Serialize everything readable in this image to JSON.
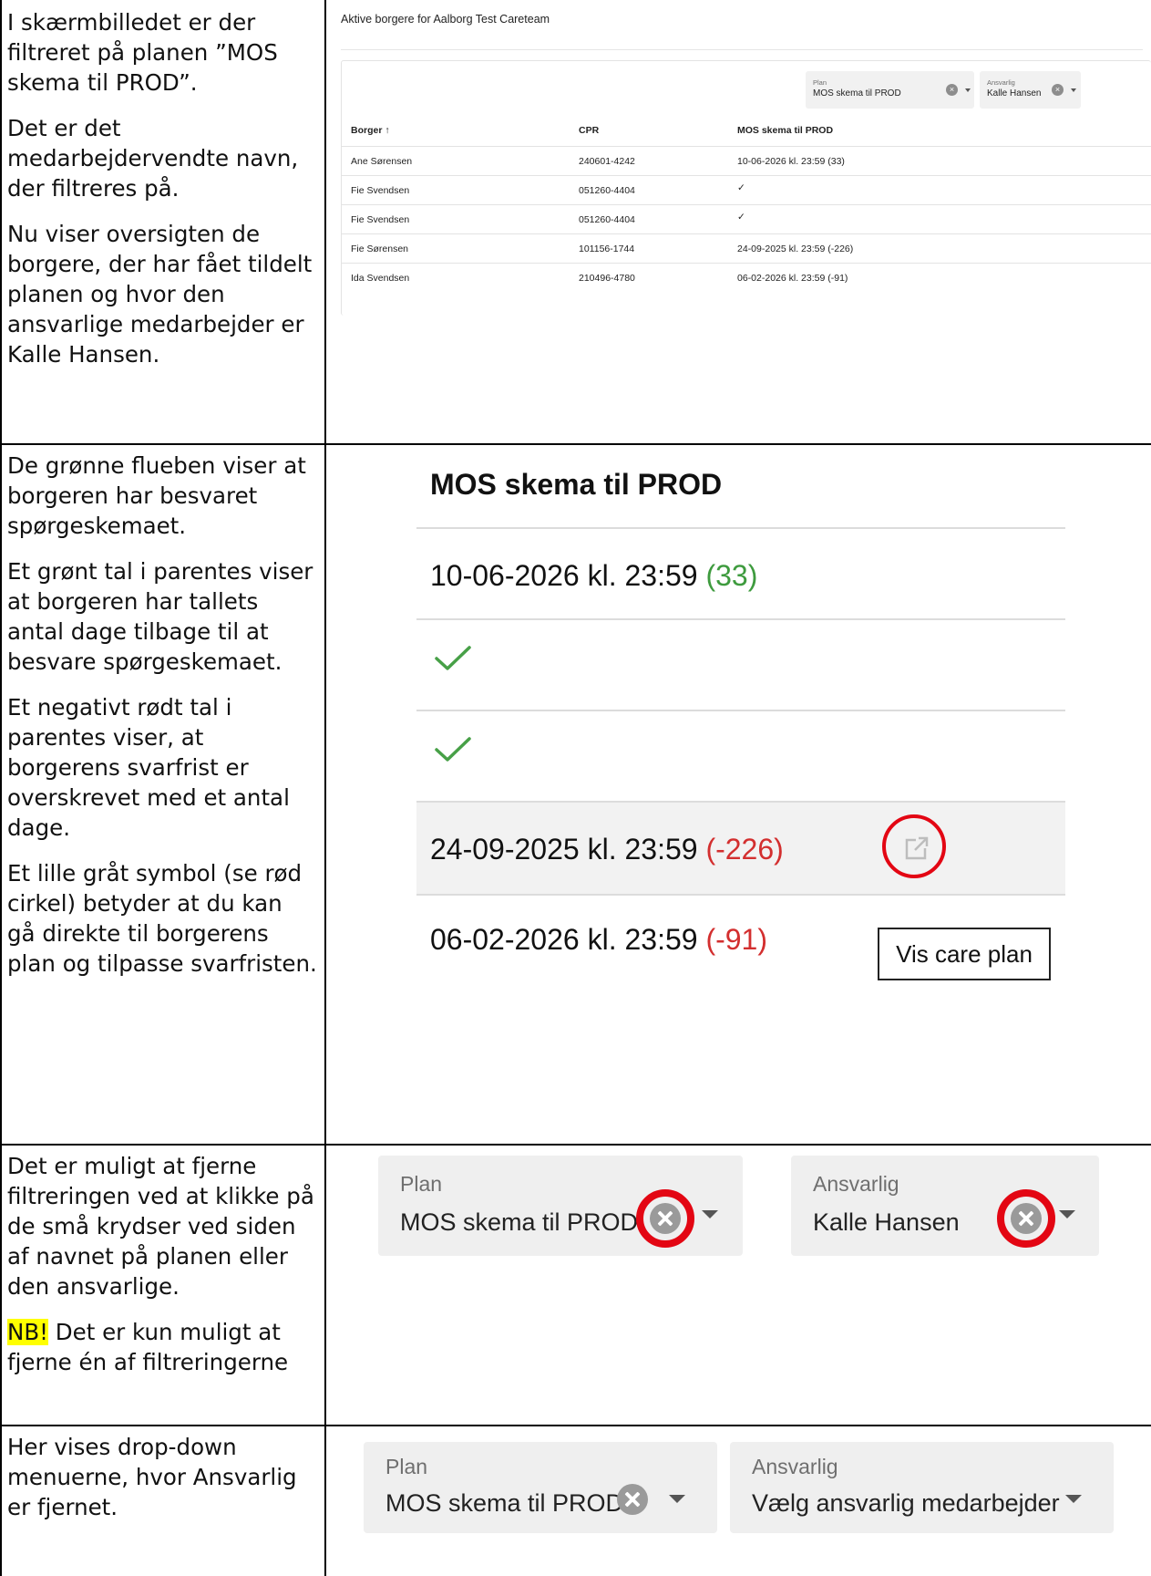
{
  "left_column": {
    "section1": [
      "I skærmbilledet er der filtreret på planen ”MOS skema til PROD”.",
      "Det er det medarbejdervendte navn, der filtreres på.",
      "Nu viser oversigten de borgere, der har fået tildelt planen og hvor den ansvarlige medarbejder er Kalle Hansen."
    ],
    "section2": [
      "De grønne flueben viser at borgeren har besvaret spørgeskemaet.",
      "Et grønt tal i parentes viser at borgeren har tallets antal dage tilbage til at besvare spørgeskemaet.",
      "Et negativt rødt tal i parentes viser, at borgerens svarfrist er overskrevet med et antal dage.",
      "Et lille gråt symbol (se rød cirkel) betyder at du kan gå direkte til borgerens plan og tilpasse svarfristen."
    ],
    "section3": {
      "p1": "Det er muligt at fjerne filtreringen ved at klikke på de små krydser ved siden af navnet på planen eller den ansvarlige.",
      "nb_label": "NB!",
      "nb_text": " Det er kun muligt at fjerne én af filtreringerne"
    },
    "section4": [
      "Her vises drop-down menuerne, hvor Ansvarlig er fjernet."
    ]
  },
  "overview": {
    "heading": "Aktive borgere for Aalborg Test Careteam",
    "plan_filter": {
      "label": "Plan",
      "value": "MOS skema til PROD"
    },
    "responsible_filter": {
      "label": "Ansvarlig",
      "value": "Kalle Hansen"
    },
    "columns": {
      "borger": "Borger ↑",
      "cpr": "CPR",
      "plan": "MOS skema til PROD"
    },
    "rows": [
      {
        "name": "Ane Sørensen",
        "cpr": "240601-4242",
        "date": "10-06-2026 kl. 23:59 ",
        "days": "(33)",
        "status": "green"
      },
      {
        "name": "Fie Svendsen",
        "cpr": "051260-4404",
        "date": "",
        "days": "",
        "status": "check"
      },
      {
        "name": "Fie Svendsen",
        "cpr": "051260-4404",
        "date": "",
        "days": "",
        "status": "check"
      },
      {
        "name": "Fie Sørensen",
        "cpr": "101156-1744",
        "date": "24-09-2025 kl. 23:59 ",
        "days": "(-226)",
        "status": "red"
      },
      {
        "name": "Ida Svendsen",
        "cpr": "210496-4780",
        "date": "06-02-2026 kl. 23:59 ",
        "days": "(-91)",
        "status": "red"
      }
    ]
  },
  "zoom": {
    "title": "MOS skema til PROD",
    "row1_date": "10-06-2026 kl. 23:59 ",
    "row1_days": "(33)",
    "row4_date": "24-09-2025 kl. 23:59 ",
    "row4_days": "(-226)",
    "row5_date": "06-02-2026 kl. 23:59 ",
    "row5_days": "(-91)",
    "tooltip": "Vis care plan"
  },
  "filters_zoom": {
    "plan_label": "Plan",
    "plan_value": "MOS skema til PROD",
    "responsible_label": "Ansvarlig",
    "responsible_value": "Kalle Hansen"
  },
  "filters_removed": {
    "plan_label": "Plan",
    "plan_value": "MOS skema til PROD",
    "responsible_label": "Ansvarlig",
    "responsible_placeholder": "Vælg ansvarlig medarbejder"
  },
  "colors": {
    "green": "#3e9b3e",
    "red": "#d32f2f",
    "ring": "#e30613",
    "highlight": "#ffff00"
  },
  "icons": [
    "arrow-up-icon",
    "checkmark-icon",
    "clear-icon",
    "dropdown-arrow-icon",
    "external-link-icon"
  ]
}
